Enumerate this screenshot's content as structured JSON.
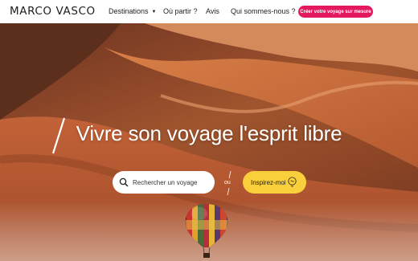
{
  "header": {
    "logo": "MARCO VASCO",
    "nav": {
      "destinations": "Destinations",
      "ou_partir": "Où partir ?",
      "avis": "Avis",
      "qui_sommes_nous": "Qui sommes-nous ?"
    },
    "cta_label": "Créer votre voyage sur mesure",
    "colors": {
      "cta": "#e3185f",
      "text": "#1d1d1b"
    }
  },
  "hero": {
    "title": "Vivre son voyage l'esprit libre",
    "search": {
      "placeholder": "Rechercher un voyage"
    },
    "or_label": "ou",
    "inspire_label": "Inspirez-moi",
    "colors": {
      "inspire_button": "#f9cf3c",
      "dune": "#c8683a"
    },
    "icons": [
      "search-icon",
      "lightbulb-icon",
      "hot-air-balloon"
    ]
  }
}
